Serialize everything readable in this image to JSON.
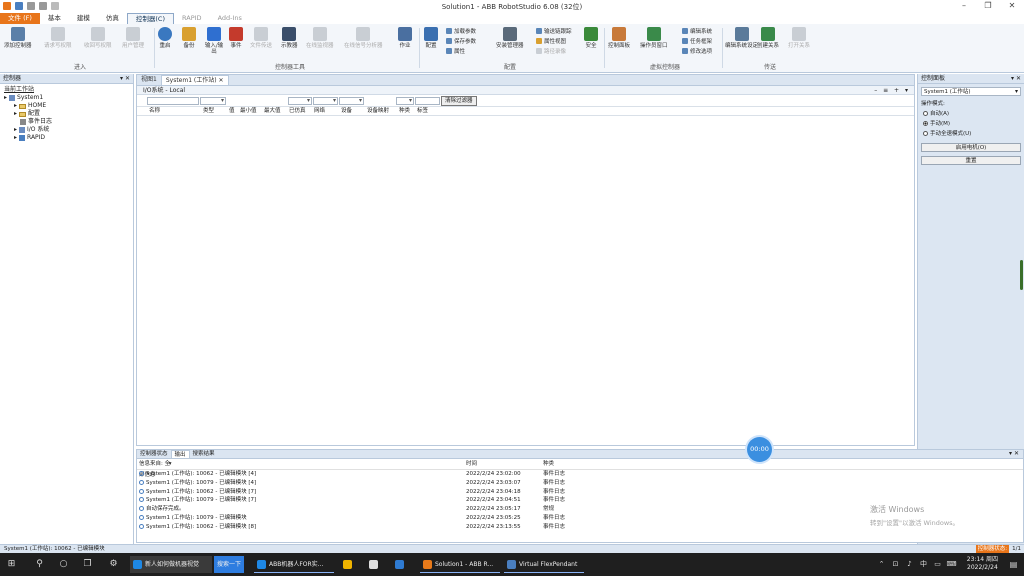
{
  "window": {
    "title": "Solution1 - ABB RobotStudio 6.08 (32位)",
    "controls": [
      "–",
      "❐",
      "✕"
    ]
  },
  "ribbon_tabs": [
    "文件 (F)",
    "基本",
    "建模",
    "仿真",
    "控制器(C)",
    "RAPID",
    "Add-Ins"
  ],
  "ribbon": {
    "groups": [
      "进入",
      "控制器工具",
      "配置",
      "虚拟控制器",
      "传送"
    ],
    "buttons": {
      "add_controller": "添加控制器",
      "request_write": "请求写权限",
      "revoke_write": "收回写权限",
      "user_manager": "用户管理",
      "restart": "重启",
      "backup": "备份",
      "io": "输入/输出",
      "events": "事件",
      "file_transfer": "文件传送",
      "fleximask": "示教器",
      "online_monitor": "在线监视器",
      "online_signal": "在线信号分析器",
      "jobs": "作业",
      "config": "配置",
      "install_manager": "安装管理器",
      "safety": "安全",
      "controller_panel": "控制面板",
      "operator_window": "操作员窗口",
      "set_task": "编辑系统设定",
      "transfer": "创建关系",
      "open_relation": "打开关系"
    },
    "small_buttons": {
      "load_params": "加载参数",
      "save_params": "保存参数",
      "props": "属性",
      "io_relation": "输送链跟踪",
      "device_browser": "属性视图",
      "path_recorder": "路径录像",
      "vc_system": "编辑系统",
      "task_frames": "任务框架",
      "edit_link": "修改选项"
    }
  },
  "left_panel": {
    "title": "控制器",
    "tree": [
      "当前工作站",
      "System1",
      "HOME",
      "配置",
      "事件日志",
      "I/O 系统",
      "RAPID"
    ]
  },
  "center": {
    "doc_tabs": [
      "视图1",
      "System1 (工作站)"
    ],
    "subtitle": "I/O系统 - Local",
    "controls": "– ≡ + ▾",
    "filter_button": "清除过滤器",
    "columns": [
      "名称",
      "类型",
      "值",
      "最小值",
      "最大值",
      "已仿真",
      "网络",
      "设备",
      "设备映射",
      "种类",
      "标签"
    ]
  },
  "right_panel": {
    "title": "控制面板",
    "system": "System1 (工作站)",
    "mode_label": "操作模式:",
    "modes": [
      {
        "label": "自动(A)",
        "on": false
      },
      {
        "label": "手动(M)",
        "on": true
      },
      {
        "label": "手动全速模式(U)",
        "on": false
      }
    ],
    "motors_button": "启用电机(O)",
    "reset_button": "重置"
  },
  "output": {
    "tabs": [
      "控制器状态",
      "输出",
      "搜索结果"
    ],
    "filter": "信息来自: 全部信息",
    "headers": [
      "时间",
      "种类"
    ],
    "rows": [
      {
        "msg": "System1 (工作站): 10062 - 已编辑模块 [4]",
        "time": "2022/2/24 23:02:00",
        "cat": "事件日志"
      },
      {
        "msg": "System1 (工作站): 10079 - 已编辑模块 [4]",
        "time": "2022/2/24 23:03:07",
        "cat": "事件日志"
      },
      {
        "msg": "System1 (工作站): 10062 - 已编辑模块 [7]",
        "time": "2022/2/24 23:04:18",
        "cat": "事件日志"
      },
      {
        "msg": "System1 (工作站): 10079 - 已编辑模块 [7]",
        "time": "2022/2/24 23:04:51",
        "cat": "事件日志"
      },
      {
        "msg": "自动保存完成。",
        "time": "2022/2/24 23:05:17",
        "cat": "常规"
      },
      {
        "msg": "System1 (工作站): 10079 - 已编辑模块",
        "time": "2022/2/24 23:05:25",
        "cat": "事件日志"
      },
      {
        "msg": "System1 (工作站): 10062 - 已编辑模块 [8]",
        "time": "2022/2/24 23:13:55",
        "cat": "事件日志"
      }
    ]
  },
  "timer": "00:00",
  "watermark": {
    "line1": "激活 Windows",
    "line2": "转到\"设置\"以激活 Windows。"
  },
  "status": {
    "left": "System1 (工作站): 10062 - 已编辑模块",
    "right_label": "控制器状态:",
    "right_value": "1/1"
  },
  "taskbar": {
    "apps": [
      {
        "label": "新人如何做机器视觉",
        "color": "#1e88e5"
      },
      {
        "label": "搜索一下",
        "color": "#2e7de0"
      },
      {
        "label": "ABB机器人FOR实...",
        "color": "#1e88e5"
      },
      {
        "label": "",
        "color": "#f0b400"
      },
      {
        "label": "",
        "color": "#e0e0e0"
      },
      {
        "label": "",
        "color": "#2f7bd2"
      },
      {
        "label": "Solution1 - ABB R...",
        "color": "#e87a1a"
      },
      {
        "label": "Virtual FlexPendant",
        "color": "#4a7fc0"
      }
    ],
    "time": "23:14 周四",
    "date": "2022/2/24"
  },
  "colors": {
    "accent": "#e8751a",
    "ribbon_bg": "#f3f6fa",
    "panel_bg": "#dbe5f1"
  }
}
